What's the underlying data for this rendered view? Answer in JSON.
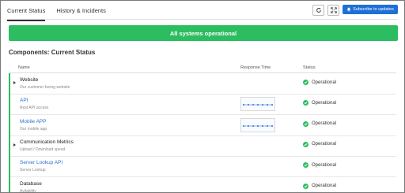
{
  "tabs": [
    {
      "label": "Current Status",
      "active": true
    },
    {
      "label": "History & Incidents",
      "active": false
    }
  ],
  "toolbar": {
    "refresh_icon": "refresh-icon",
    "fullscreen_icon": "fullscreen-icon",
    "subscribe_label": "Subscribe to updates"
  },
  "banner": {
    "text": "All systems operational",
    "color": "#2bbd5f"
  },
  "section": {
    "title": "Components: Current Status"
  },
  "table": {
    "headers": {
      "name": "Name",
      "response_time": "Response Time",
      "status": "Status"
    },
    "rows": [
      {
        "name": "Website",
        "description": "Our customer facing website",
        "group": true,
        "link": false,
        "has_sparkline": false,
        "status": "Operational"
      },
      {
        "name": "API",
        "description": "Rest API access",
        "group": false,
        "link": true,
        "has_sparkline": true,
        "status": "Operational"
      },
      {
        "name": "Mobile APP",
        "description": "Our mobile app",
        "group": false,
        "link": true,
        "has_sparkline": true,
        "status": "Operational"
      },
      {
        "name": "Communication Metrics",
        "description": "Upload / Download speed",
        "group": true,
        "link": false,
        "has_sparkline": false,
        "status": "Operational"
      },
      {
        "name": "Server Lookup API",
        "description": "Server Lookup",
        "group": false,
        "link": true,
        "has_sparkline": false,
        "status": "Operational"
      },
      {
        "name": "Database",
        "description": "Avilability",
        "group": false,
        "link": false,
        "has_sparkline": false,
        "status": "Operational"
      }
    ]
  },
  "colors": {
    "accent": "#1e6fd6",
    "ok": "#2bbd5f",
    "link": "#2a73d9"
  }
}
